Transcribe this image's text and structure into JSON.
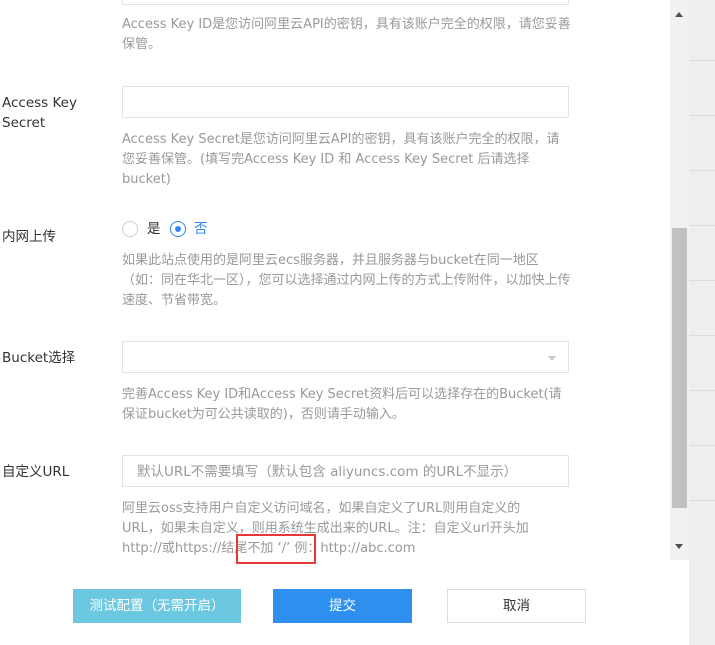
{
  "access_key_id": {
    "help": "Access Key ID是您访问阿里云API的密钥，具有该账户完全的权限，请您妥善保管。"
  },
  "access_key_secret": {
    "label_line1": "Access Key",
    "label_line2": "Secret",
    "value": "",
    "help": "Access Key Secret是您访问阿里云API的密钥，具有该账户完全的权限，请您妥善保管。(填写完Access Key ID 和 Access Key Secret 后请选择bucket)"
  },
  "intranet_upload": {
    "label": "内网上传",
    "options": [
      {
        "label": "是",
        "checked": false
      },
      {
        "label": "否",
        "checked": true
      }
    ],
    "help": "如果此站点使用的是阿里云ecs服务器，并且服务器与bucket在同一地区（如：同在华北一区），您可以选择通过内网上传的方式上传附件，以加快上传速度、节省带宽。"
  },
  "bucket": {
    "label": "Bucket选择",
    "selected": "",
    "help": "完善Access Key ID和Access Key Secret资料后可以选择存在的Bucket(请保证bucket为可公共读取的)，否则请手动输入。"
  },
  "custom_url": {
    "label": "自定义URL",
    "placeholder": "默认URL不需要填写（默认包含 aliyuncs.com 的URL不显示）",
    "help_line1": "阿里云oss支持用户自定义访问域名，如果自定义了URL则用自定义的",
    "help_line2": "URL，如果未自定义，则用系统生成出来的URL。注：自定义url开头加",
    "help_line3": "http://或https://结尾不加 ‘/’ 例：http://abc.com"
  },
  "buttons": {
    "test": "测试配置（无需开启）",
    "submit": "提交",
    "cancel": "取消"
  },
  "colors": {
    "primary": "#2f8fef",
    "test_button": "#6cc8e0",
    "highlight": "#e53935"
  }
}
